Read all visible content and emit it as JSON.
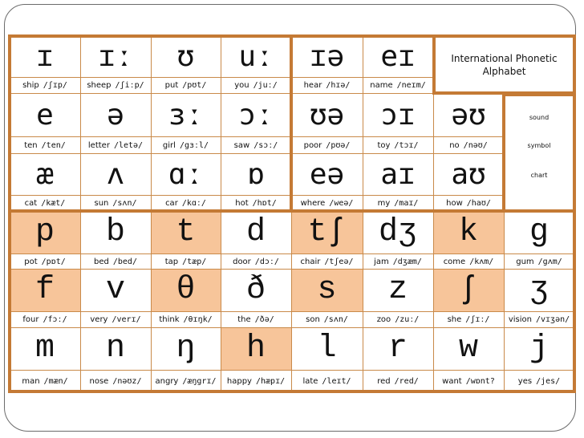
{
  "title": {
    "line1": "International Phonetic",
    "line2": "Alphabet"
  },
  "side_labels": [
    "sound",
    "symbol",
    "chart"
  ],
  "colors": {
    "border": "#c47a35",
    "highlight": "#f7c59a",
    "thin_line": "#c98a4a"
  },
  "rows": [
    [
      {
        "symbol": "ɪ",
        "word": "ship",
        "ipa": "/ʃɪp/",
        "highlight": false
      },
      {
        "symbol": "ɪː",
        "word": "sheep",
        "ipa": "/ʃiːp/",
        "highlight": false
      },
      {
        "symbol": "ʊ",
        "word": "put",
        "ipa": "/pʊt/",
        "highlight": false
      },
      {
        "symbol": "uː",
        "word": "you",
        "ipa": "/juː/",
        "highlight": false
      },
      {
        "symbol": "ɪə",
        "word": "hear",
        "ipa": "/hɪə/",
        "highlight": false
      },
      {
        "symbol": "eɪ",
        "word": "name",
        "ipa": "/neɪm/",
        "highlight": false
      }
    ],
    [
      {
        "symbol": "e",
        "word": "ten",
        "ipa": "/ten/",
        "highlight": false
      },
      {
        "symbol": "ə",
        "word": "letter",
        "ipa": "/letə/",
        "highlight": false
      },
      {
        "symbol": "ɜː",
        "word": "girl",
        "ipa": "/gɜːl/",
        "highlight": false
      },
      {
        "symbol": "ɔː",
        "word": "saw",
        "ipa": "/sɔː/",
        "highlight": false
      },
      {
        "symbol": "ʊə",
        "word": "poor",
        "ipa": "/pʊə/",
        "highlight": false
      },
      {
        "symbol": "ɔɪ",
        "word": "toy",
        "ipa": "/tɔɪ/",
        "highlight": false
      },
      {
        "symbol": "əʊ",
        "word": "no",
        "ipa": "/nəʊ/",
        "highlight": false
      }
    ],
    [
      {
        "symbol": "æ",
        "word": "cat",
        "ipa": "/kæt/",
        "highlight": false
      },
      {
        "symbol": "ʌ",
        "word": "sun",
        "ipa": "/sʌn/",
        "highlight": false
      },
      {
        "symbol": "ɑː",
        "word": "car",
        "ipa": "/kɑː/",
        "highlight": false
      },
      {
        "symbol": "ɒ",
        "word": "hot",
        "ipa": "/hɒt/",
        "highlight": false
      },
      {
        "symbol": "eə",
        "word": "where",
        "ipa": "/weə/",
        "highlight": false
      },
      {
        "symbol": "aɪ",
        "word": "my",
        "ipa": "/maɪ/",
        "highlight": false
      },
      {
        "symbol": "aʊ",
        "word": "how",
        "ipa": "/haʊ/",
        "highlight": false
      }
    ],
    [
      {
        "symbol": "p",
        "word": "pot",
        "ipa": "/pɒt/",
        "highlight": true
      },
      {
        "symbol": "b",
        "word": "bed",
        "ipa": "/bed/",
        "highlight": false
      },
      {
        "symbol": "t",
        "word": "tap",
        "ipa": "/tæp/",
        "highlight": true
      },
      {
        "symbol": "d",
        "word": "door",
        "ipa": "/dɔː/",
        "highlight": false
      },
      {
        "symbol": "tʃ",
        "word": "chair",
        "ipa": "/tʃeə/",
        "highlight": true
      },
      {
        "symbol": "dʒ",
        "word": "jam",
        "ipa": "/dʒæm/",
        "highlight": false
      },
      {
        "symbol": "k",
        "word": "come",
        "ipa": "/kʌm/",
        "highlight": true
      },
      {
        "symbol": "g",
        "word": "gum",
        "ipa": "/gʌm/",
        "highlight": false
      }
    ],
    [
      {
        "symbol": "f",
        "word": "four",
        "ipa": "/fɔː/",
        "highlight": true
      },
      {
        "symbol": "v",
        "word": "very",
        "ipa": "/verɪ/",
        "highlight": false
      },
      {
        "symbol": "θ",
        "word": "think",
        "ipa": "/θɪŋk/",
        "highlight": true
      },
      {
        "symbol": "ð",
        "word": "the",
        "ipa": "/ðə/",
        "highlight": false
      },
      {
        "symbol": "s",
        "word": "son",
        "ipa": "/sʌn/",
        "highlight": true
      },
      {
        "symbol": "z",
        "word": "zoo",
        "ipa": "/zuː/",
        "highlight": false
      },
      {
        "symbol": "ʃ",
        "word": "she",
        "ipa": "/ʃɪː/",
        "highlight": true
      },
      {
        "symbol": "ʒ",
        "word": "vision",
        "ipa": "/vɪʒən/",
        "highlight": false
      }
    ],
    [
      {
        "symbol": "m",
        "word": "man",
        "ipa": "/mæn/",
        "highlight": false
      },
      {
        "symbol": "n",
        "word": "nose",
        "ipa": "/nəʊz/",
        "highlight": false
      },
      {
        "symbol": "ŋ",
        "word": "angry",
        "ipa": "/æŋgrɪ/",
        "highlight": false
      },
      {
        "symbol": "h",
        "word": "happy",
        "ipa": "/hæpɪ/",
        "highlight": true
      },
      {
        "symbol": "l",
        "word": "late",
        "ipa": "/leɪt/",
        "highlight": false
      },
      {
        "symbol": "r",
        "word": "red",
        "ipa": "/red/",
        "highlight": false
      },
      {
        "symbol": "w",
        "word": "want",
        "ipa": "/wɒnt?",
        "highlight": false
      },
      {
        "symbol": "j",
        "word": "yes",
        "ipa": "/jes/",
        "highlight": false
      }
    ]
  ]
}
